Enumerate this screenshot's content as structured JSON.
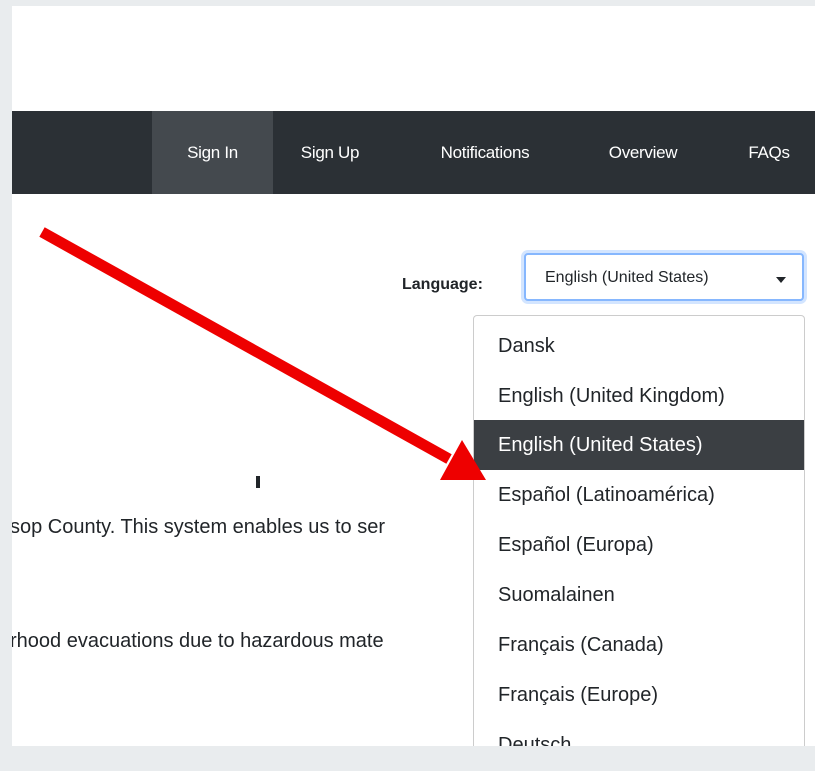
{
  "nav": {
    "items": [
      {
        "label": "Sign In",
        "active": true
      },
      {
        "label": "Sign Up",
        "active": false
      },
      {
        "label": "Notifications",
        "active": false
      },
      {
        "label": "Overview",
        "active": false
      },
      {
        "label": "FAQs",
        "active": false
      }
    ]
  },
  "language": {
    "label": "Language:",
    "selected": "English (United States)",
    "options": [
      "Dansk",
      "English (United Kingdom)",
      "English (United States)",
      "Español (Latinoamérica)",
      "Español (Europa)",
      "Suomalainen",
      "Français (Canada)",
      "Français (Europe)",
      "Deutsch"
    ]
  },
  "body": {
    "line1": "sop County. This system enables us to ser",
    "line2": "rhood evacuations due to hazardous mate"
  },
  "annotation": {
    "arrow_color": "#ee0000"
  }
}
